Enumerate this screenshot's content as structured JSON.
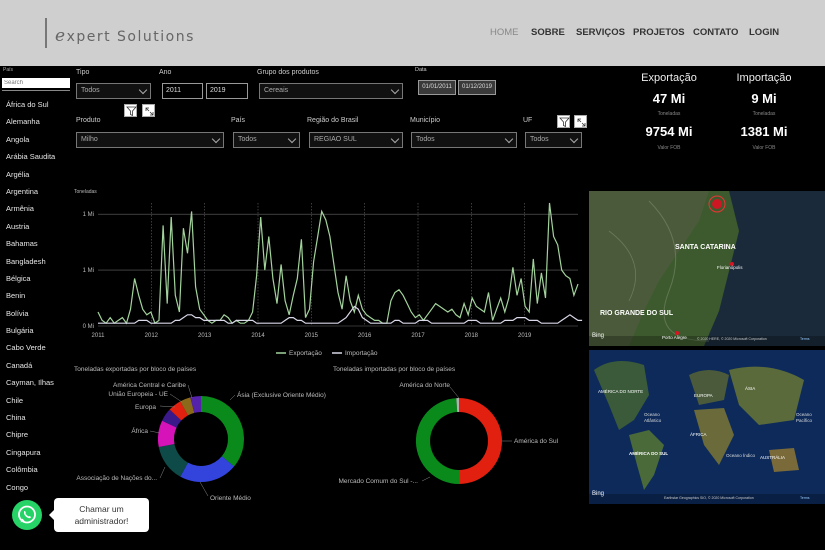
{
  "header": {
    "logo_initial": "e",
    "logo_rest": "xpert Solutions",
    "nav": [
      "HOME",
      "SOBRE",
      "SERVIÇOS",
      "PROJETOS",
      "CONTATO",
      "LOGIN"
    ]
  },
  "sidebar": {
    "label": "País",
    "search_placeholder": "Search",
    "countries": [
      "África do Sul",
      "Alemanha",
      "Angola",
      "Arábia Saudita",
      "Argélia",
      "Argentina",
      "Armênia",
      "Austria",
      "Bahamas",
      "Bangladesh",
      "Bélgica",
      "Benin",
      "Bolívia",
      "Bulgária",
      "Cabo Verde",
      "Canadá",
      "Cayman, Ilhas",
      "Chile",
      "China",
      "Chipre",
      "Cingapura",
      "Colômbia",
      "Congo"
    ]
  },
  "filters": {
    "tipo": {
      "label": "Tipo",
      "value": "Todos"
    },
    "ano": {
      "label": "Ano",
      "from": "2011",
      "to": "2019"
    },
    "grupo": {
      "label": "Grupo dos produtos",
      "value": "Cereais"
    },
    "data": {
      "label": "Data",
      "from": "01/01/2011",
      "to": "01/12/2019"
    },
    "produto": {
      "label": "Produto",
      "value": "Milho"
    },
    "pais": {
      "label": "País",
      "value": "Todos"
    },
    "regiao": {
      "label": "Região do Brasil",
      "value": "REGIAO SUL"
    },
    "municipio": {
      "label": "Município",
      "value": "Todos"
    },
    "uf": {
      "label": "UF",
      "value": "Todos"
    }
  },
  "kpis": {
    "exportacao": {
      "title": "Exportação",
      "tons": "47 Mi",
      "tons_label": "Toneladas",
      "fob": "9754 Mi",
      "fob_label": "Valor FOB"
    },
    "importacao": {
      "title": "Importação",
      "tons": "9 Mi",
      "tons_label": "Toneladas",
      "fob": "1381 Mi",
      "fob_label": "Valor FOB"
    }
  },
  "line_chart": {
    "ylabel": "Toneladas",
    "legend": [
      "Exportação",
      "Importação"
    ]
  },
  "donut_export_title": "Toneladas exportadas por bloco de países",
  "donut_import_title": "Toneladas importadas por bloco de países",
  "maps": {
    "regional": {
      "labels": [
        "SANTA CATARINA",
        "RIO GRANDE DO SUL",
        "Florianópolis",
        "Porto Alegre"
      ],
      "credit": "© 2020 HERE, © 2020 Microsoft Corporation",
      "terms": "Terms",
      "brand": "Bing"
    },
    "world": {
      "labels": [
        "AMÉRICA DO NORTE",
        "EUROPA",
        "ÁSIA",
        "Oceano Atlântico",
        "Oceano Pacífico",
        "ÁFRICA",
        "AMÉRICA DO SUL",
        "Oceano Índico",
        "AUSTRÁLIA"
      ],
      "credit": "Earthstar Geographics SIO, © 2020 Microsoft Corporation",
      "terms": "Terms",
      "brand": "Bing"
    }
  },
  "whatsapp": {
    "line1": "Chamar um",
    "line2": "administrador!"
  },
  "colors": {
    "export": "#a3d39c",
    "import": "#d8d8e8",
    "green": "#0a8a1a",
    "red": "#e1200f"
  },
  "chart_data": [
    {
      "type": "line",
      "ylabel": "Toneladas",
      "x_ticks": [
        "2011",
        "2012",
        "2013",
        "2014",
        "2015",
        "2016",
        "2017",
        "2018",
        "2019"
      ],
      "y_ticks": [
        "0 Mi",
        "1 Mi",
        "1 Mi"
      ],
      "ylim": [
        0,
        2.2
      ],
      "series": [
        {
          "name": "Exportação",
          "values": [
            0.25,
            0.1,
            0.05,
            0.15,
            0.05,
            0.1,
            0.15,
            0.05,
            0.3,
            0.85,
            0.55,
            0.3,
            0.2,
            0.25,
            0.05,
            0.1,
            1.8,
            0.4,
            1.95,
            0.55,
            0.25,
            1.75,
            1.3,
            2.05,
            0.7,
            0.3,
            0.2,
            0.1,
            0.05,
            0.1,
            0.1,
            0.2,
            0.15,
            0.05,
            0.1,
            0.05,
            0.05,
            0.1,
            0.25,
            0.9,
            1.95,
            1.0,
            1.6,
            0.85,
            0.4,
            1.1,
            0.45,
            0.2,
            0.55,
            0.85,
            1.55,
            0.15,
            0.3,
            1.15,
            1.6,
            2.05,
            1.9,
            1.6,
            1.1,
            0.6,
            0.3,
            0.9,
            0.45,
            0.25,
            0.55,
            0.3,
            0.2,
            0.15,
            0.1,
            0.1,
            0.05,
            0.05,
            0.45,
            0.6,
            0.65,
            0.55,
            0.4,
            0.25,
            0.15,
            0.2,
            0.1,
            0.2,
            0.3,
            0.4,
            0.35,
            0.3,
            0.25,
            0.3,
            0.2,
            0.15,
            0.4,
            0.2,
            0.5,
            0.35,
            0.3,
            0.25,
            0.6,
            0.1,
            0.3,
            0.5,
            0.25,
            0.5,
            1.05,
            0.55,
            0.85,
            0.35,
            0.25,
            1.2,
            0.4,
            0.95,
            0.5,
            2.2,
            1.6,
            1.45,
            1.0,
            0.9,
            0.85,
            0.55,
            0.75
          ]
        },
        {
          "name": "Importação",
          "values": [
            0.05,
            0.05,
            0.05,
            0.05,
            0.05,
            0.05,
            0.05,
            0.05,
            0.05,
            0.05,
            0.1,
            0.1,
            0.1,
            0.05,
            0.05,
            0.05,
            0.05,
            0.05,
            0.05,
            0.1,
            0.1,
            0.15,
            0.2,
            0.2,
            0.15,
            0.15,
            0.1,
            0.1,
            0.1,
            0.1,
            0.1,
            0.1,
            0.05,
            0.05,
            0.1,
            0.1,
            0.1,
            0.1,
            0.1,
            0.05,
            0.05,
            0.05,
            0.05,
            0.05,
            0.05,
            0.05,
            0.1,
            0.15,
            0.15,
            0.1,
            0.1,
            0.05,
            0.05,
            0.05,
            0.05,
            0.05,
            0.05,
            0.05,
            0.05,
            0.05,
            0.1,
            0.15,
            0.25,
            0.35,
            0.3,
            0.15,
            0.1,
            0.05,
            0.05,
            0.05,
            0.05,
            0.05,
            0.05,
            0.1,
            0.1,
            0.05,
            0.05,
            0.05,
            0.05,
            0.1,
            0.1,
            0.1,
            0.05,
            0.05,
            0.05,
            0.05,
            0.05,
            0.05,
            0.05,
            0.05,
            0.05,
            0.1,
            0.1,
            0.1,
            0.05,
            0.05,
            0.05,
            0.05,
            0.05,
            0.05,
            0.1,
            0.1,
            0.1,
            0.15,
            0.15,
            0.15,
            0.1,
            0.1,
            0.1,
            0.05,
            0.05,
            0.05,
            0.05,
            0.05,
            0.1,
            0.15,
            0.2,
            0.15,
            0.1,
            0.1
          ]
        }
      ]
    },
    {
      "type": "pie",
      "title": "Toneladas exportadas por bloco de países",
      "slices": [
        {
          "name": "Ásia (Exclusive Oriente Médio)",
          "value": 36,
          "color": "#0a8a1a"
        },
        {
          "name": "Oriente Médio",
          "value": 22,
          "color": "#3344dd"
        },
        {
          "name": "Associação de Nações do...",
          "value": 14,
          "color": "#0d4a48"
        },
        {
          "name": "África",
          "value": 10,
          "color": "#d613b9"
        },
        {
          "name": "Europa",
          "value": 5,
          "color": "#3a1a8a"
        },
        {
          "name": "União Europeia - UE",
          "value": 5,
          "color": "#e1200f"
        },
        {
          "name": "América Central e Caribe",
          "value": 4,
          "color": "#8a6a1a"
        },
        {
          "name": "",
          "value": 4,
          "color": "#5522aa"
        }
      ]
    },
    {
      "type": "pie",
      "title": "Toneladas importadas por bloco de países",
      "slices": [
        {
          "name": "América do Sul",
          "value": 50,
          "color": "#e1200f"
        },
        {
          "name": "Mercado Comum do Sul -...",
          "value": 49,
          "color": "#0a8a1a"
        },
        {
          "name": "América do Norte",
          "value": 1,
          "color": "#b0b0b0"
        }
      ]
    }
  ]
}
